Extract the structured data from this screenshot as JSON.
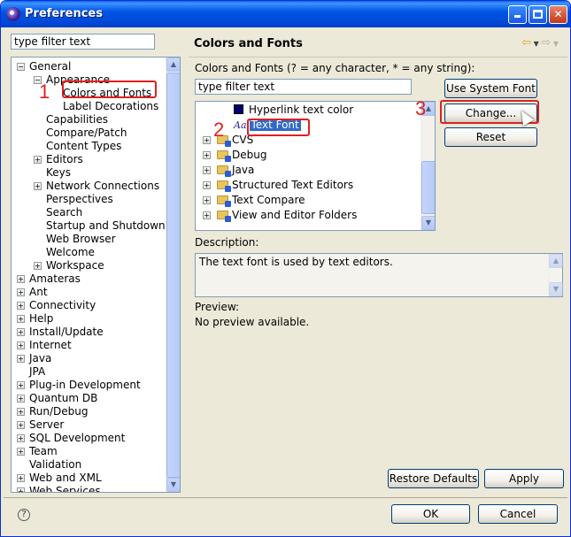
{
  "window": {
    "title": "Preferences"
  },
  "left": {
    "filter_value": "type filter text",
    "tree": [
      {
        "label": "General",
        "level": 0,
        "expander": "minus"
      },
      {
        "label": "Appearance",
        "level": 1,
        "expander": "minus"
      },
      {
        "label": "Colors and Fonts",
        "level": 2,
        "expander": "none",
        "highlight": true
      },
      {
        "label": "Label Decorations",
        "level": 2,
        "expander": "none"
      },
      {
        "label": "Capabilities",
        "level": 1,
        "expander": "none"
      },
      {
        "label": "Compare/Patch",
        "level": 1,
        "expander": "none"
      },
      {
        "label": "Content Types",
        "level": 1,
        "expander": "none"
      },
      {
        "label": "Editors",
        "level": 1,
        "expander": "plus"
      },
      {
        "label": "Keys",
        "level": 1,
        "expander": "none"
      },
      {
        "label": "Network Connections",
        "level": 1,
        "expander": "plus"
      },
      {
        "label": "Perspectives",
        "level": 1,
        "expander": "none"
      },
      {
        "label": "Search",
        "level": 1,
        "expander": "none"
      },
      {
        "label": "Startup and Shutdown",
        "level": 1,
        "expander": "none"
      },
      {
        "label": "Web Browser",
        "level": 1,
        "expander": "none"
      },
      {
        "label": "Welcome",
        "level": 1,
        "expander": "none"
      },
      {
        "label": "Workspace",
        "level": 1,
        "expander": "plus"
      },
      {
        "label": "Amateras",
        "level": 0,
        "expander": "plus"
      },
      {
        "label": "Ant",
        "level": 0,
        "expander": "plus"
      },
      {
        "label": "Connectivity",
        "level": 0,
        "expander": "plus"
      },
      {
        "label": "Help",
        "level": 0,
        "expander": "plus"
      },
      {
        "label": "Install/Update",
        "level": 0,
        "expander": "plus"
      },
      {
        "label": "Internet",
        "level": 0,
        "expander": "plus"
      },
      {
        "label": "Java",
        "level": 0,
        "expander": "plus"
      },
      {
        "label": "JPA",
        "level": 0,
        "expander": "none"
      },
      {
        "label": "Plug-in Development",
        "level": 0,
        "expander": "plus"
      },
      {
        "label": "Quantum DB",
        "level": 0,
        "expander": "plus"
      },
      {
        "label": "Run/Debug",
        "level": 0,
        "expander": "plus"
      },
      {
        "label": "Server",
        "level": 0,
        "expander": "plus"
      },
      {
        "label": "SQL Development",
        "level": 0,
        "expander": "plus"
      },
      {
        "label": "Team",
        "level": 0,
        "expander": "plus"
      },
      {
        "label": "Validation",
        "level": 0,
        "expander": "none"
      },
      {
        "label": "Web and XML",
        "level": 0,
        "expander": "plus"
      },
      {
        "label": "Web Services",
        "level": 0,
        "expander": "plus"
      }
    ]
  },
  "right": {
    "title": "Colors and Fonts",
    "hint": "Colors and Fonts (? = any character, * = any string):",
    "filter_value": "type filter text",
    "tree": [
      {
        "label": "Hyperlink text color",
        "kind": "color"
      },
      {
        "label": "Text Font",
        "kind": "font",
        "selected": true
      },
      {
        "label": "CVS",
        "kind": "folder"
      },
      {
        "label": "Debug",
        "kind": "folder"
      },
      {
        "label": "Java",
        "kind": "folder"
      },
      {
        "label": "Structured Text Editors",
        "kind": "folder"
      },
      {
        "label": "Text Compare",
        "kind": "folder"
      },
      {
        "label": "View and Editor Folders",
        "kind": "folder"
      }
    ],
    "buttons": {
      "use_system_font": "Use System Font",
      "change": "Change...",
      "reset": "Reset",
      "restore_defaults": "Restore Defaults",
      "apply": "Apply"
    },
    "description_label": "Description:",
    "description_text": "The text font is used by text editors.",
    "preview_label": "Preview:",
    "preview_text": "No preview available."
  },
  "footer": {
    "ok": "OK",
    "cancel": "Cancel",
    "help": "?"
  },
  "annotations": {
    "step1": "1",
    "step2": "2",
    "step3": "3"
  },
  "colors": {
    "highlight_red": "#e02020",
    "selection_blue": "#316ac5",
    "title_blue": "#0055e5"
  }
}
